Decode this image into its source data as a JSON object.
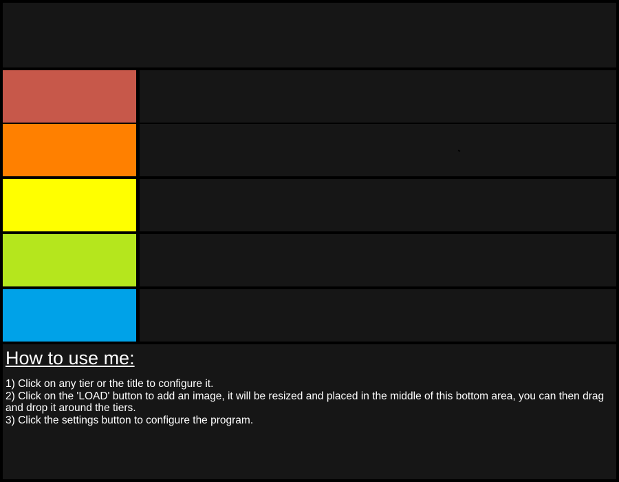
{
  "title": "",
  "tiers": [
    {
      "label": "",
      "color": "#c7584a"
    },
    {
      "label": "",
      "color": "#ff8000"
    },
    {
      "label": "",
      "color": "#ffff00"
    },
    {
      "label": "",
      "color": "#b5e61d"
    },
    {
      "label": "",
      "color": "#00a2e8"
    }
  ],
  "help": {
    "heading": "How to use me:",
    "steps": [
      "1) Click on any tier or the title to configure it.",
      "2) Click on the 'LOAD' button to add an image, it will be resized and placed in the middle of this bottom area, you can then drag and drop it around the tiers.",
      "3) Click the settings button to configure the program."
    ]
  },
  "colors": {
    "background": "#000000",
    "panel": "#161616",
    "text": "#ffffff"
  }
}
